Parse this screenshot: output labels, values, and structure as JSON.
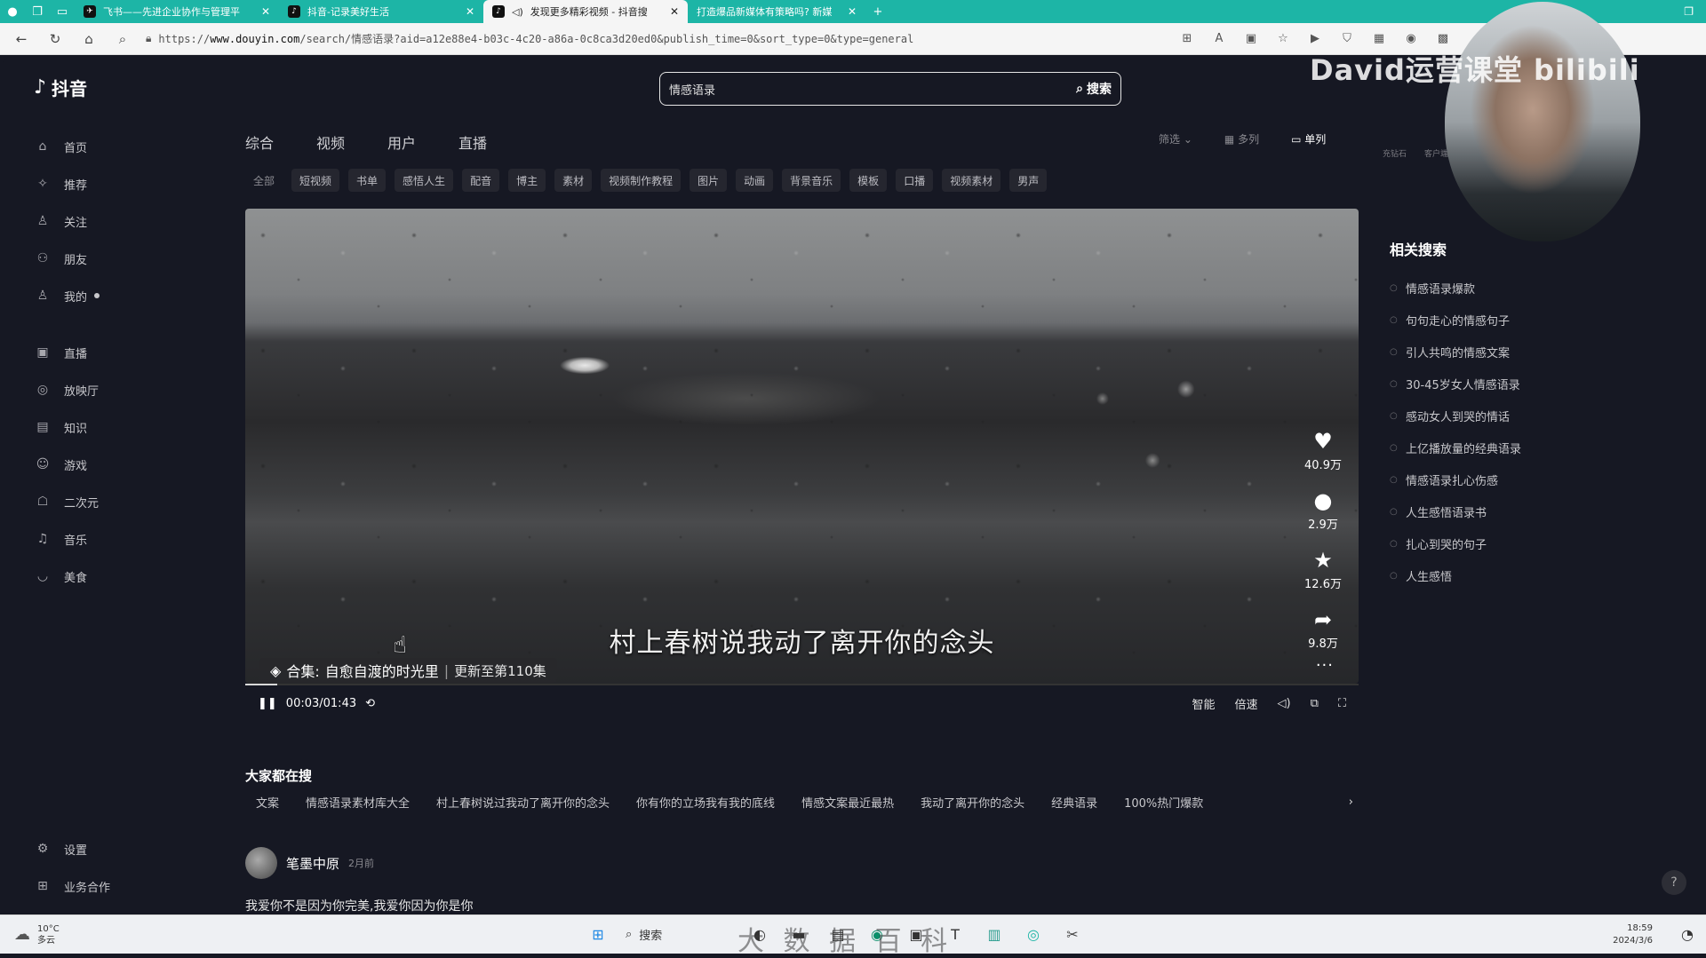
{
  "browser": {
    "tabs": [
      {
        "title": "飞书——先进企业协作与管理平",
        "icon": "feishu-icon",
        "active": false
      },
      {
        "title": "抖音-记录美好生活",
        "icon": "douyin-icon",
        "active": false
      },
      {
        "title": "发现更多精彩视频 - 抖音搜",
        "icon": "douyin-icon",
        "active": true
      },
      {
        "title": "打造爆品新媒体有策略吗? 新媒",
        "icon": "page-icon",
        "active": false
      }
    ],
    "new_tab": "+",
    "url_prefix": "https://",
    "url_domain": "www.douyin.com",
    "url_path": "/search/情感语录?aid=a12e88e4-b03c-4c20-a86a-0c8ca3d20ed0&publish_time=0&sort_type=0&type=general"
  },
  "app": {
    "logo_text": "抖音",
    "search": {
      "value": "情感语录",
      "button_label": "搜索"
    },
    "sidebar": [
      {
        "label": "首页",
        "icon": "home-icon",
        "glyph": "⌂"
      },
      {
        "label": "推荐",
        "icon": "recommend-icon",
        "glyph": "✧"
      },
      {
        "label": "关注",
        "icon": "follow-icon",
        "glyph": "♙"
      },
      {
        "label": "朋友",
        "icon": "friends-icon",
        "glyph": "⚇"
      },
      {
        "label": "我的",
        "icon": "me-icon",
        "glyph": "♙"
      }
    ],
    "sidebar2": [
      {
        "label": "直播",
        "icon": "live-icon",
        "glyph": "▣"
      },
      {
        "label": "放映厅",
        "icon": "cinema-icon",
        "glyph": "◎"
      },
      {
        "label": "知识",
        "icon": "knowledge-icon",
        "glyph": "▤"
      },
      {
        "label": "游戏",
        "icon": "game-icon",
        "glyph": "☺"
      },
      {
        "label": "二次元",
        "icon": "anime-icon",
        "glyph": "☖"
      },
      {
        "label": "音乐",
        "icon": "music-icon",
        "glyph": "♫"
      },
      {
        "label": "美食",
        "icon": "food-icon",
        "glyph": "◡"
      }
    ],
    "sidebar_bottom": [
      {
        "label": "设置",
        "icon": "settings-icon",
        "glyph": "⚙"
      },
      {
        "label": "业务合作",
        "icon": "business-icon",
        "glyph": "⊞"
      }
    ],
    "result_tabs": [
      "综合",
      "视频",
      "用户",
      "直播"
    ],
    "filter_label": "筛选",
    "view_multi": "多列",
    "view_single": "单列",
    "chips": [
      "全部",
      "短视频",
      "书单",
      "感悟人生",
      "配音",
      "博主",
      "素材",
      "视频制作教程",
      "图片",
      "动画",
      "背景音乐",
      "模板",
      "口播",
      "视频素材",
      "男声"
    ],
    "video": {
      "subtitle": "村上春树说我动了离开你的念头",
      "likes": "40.9万",
      "comments": "2.9万",
      "favorites": "12.6万",
      "shares": "9.8万",
      "collection_prefix": "合集:",
      "collection_name": "自愈自渡的时光里",
      "collection_update": "更新至第110集",
      "time": "00:03/01:43",
      "progress": 0.029,
      "ctrl_smart": "智能",
      "ctrl_speed": "倍速"
    },
    "trending_title": "大家都在搜",
    "trending": [
      "文案",
      "情感语录素材库大全",
      "村上春树说过我动了离开你的念头",
      "你有你的立场我有我的底线",
      "情感文案最近最热",
      "我动了离开你的念头",
      "经典语录",
      "100%热门爆款"
    ],
    "author": {
      "name": "笔墨中原",
      "time": "2月前"
    },
    "description": "我爱你不是因为你完美,我爱你因为你是你",
    "related_title": "相关搜索",
    "related": [
      "情感语录爆款",
      "句句走心的情感句子",
      "引人共鸣的情感文案",
      "30-45岁女人情感语录",
      "感动女人到哭的情话",
      "上亿播放量的经典语录",
      "情感语录扎心伤感",
      "人生感悟语录书",
      "扎心到哭的句子",
      "人生感悟"
    ],
    "top_right_labels": [
      "充钻石",
      "客户端"
    ]
  },
  "overlay": {
    "watermark": "David运营课堂 bilibili",
    "handwriting": "大 数 据 百 科"
  },
  "taskbar": {
    "temp": "10°C",
    "weather": "多云",
    "search_label": "搜索",
    "time": "18:59",
    "date": "2024/3/6"
  }
}
